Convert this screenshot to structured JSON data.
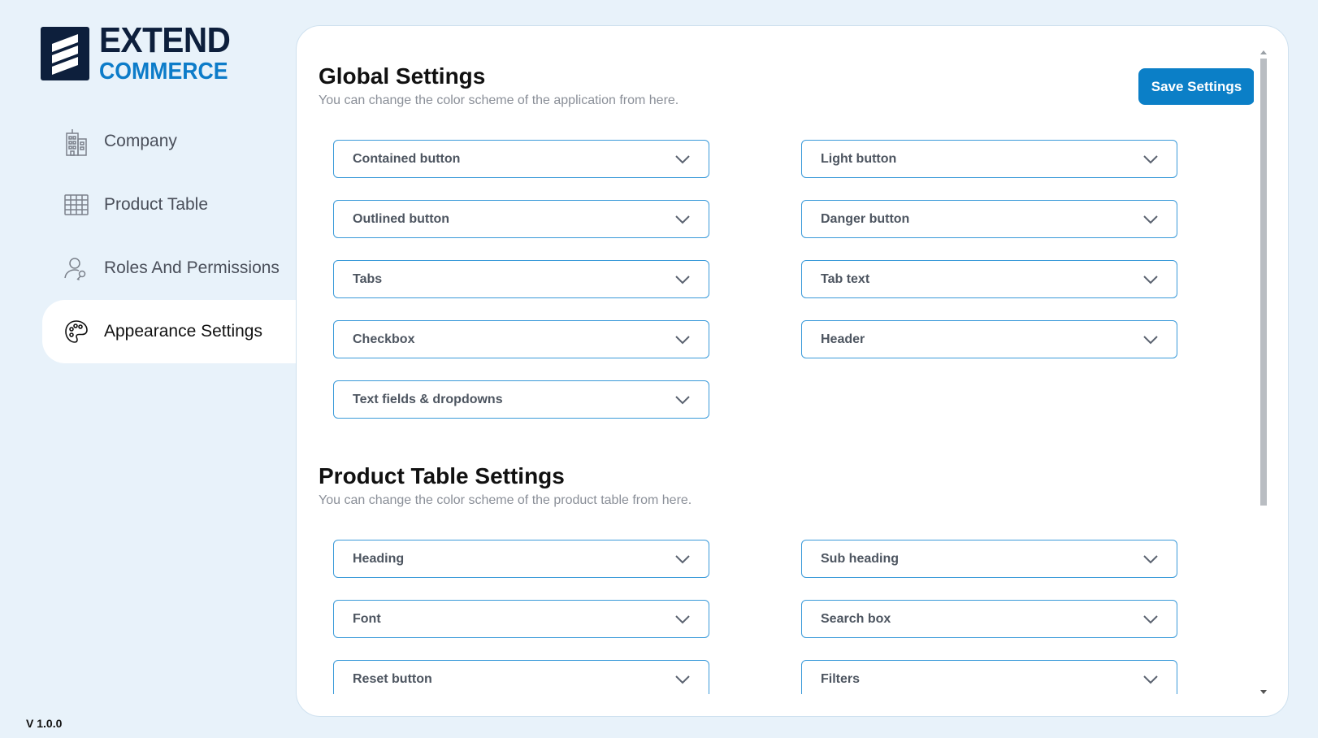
{
  "logo": {
    "line1": "EXTEND",
    "line2": "COMMERCE"
  },
  "nav": {
    "items": [
      {
        "label": "Company",
        "icon": "building-icon",
        "active": false
      },
      {
        "label": "Product Table",
        "icon": "table-grid-icon",
        "active": false
      },
      {
        "label": "Roles And Permissions",
        "icon": "user-key-icon",
        "active": false
      },
      {
        "label": "Appearance Settings",
        "icon": "palette-icon",
        "active": true
      }
    ]
  },
  "version": "V 1.0.0",
  "global": {
    "title": "Global Settings",
    "subtitle": "You can change the color scheme of the application from here.",
    "save_label": "Save Settings",
    "fields": [
      "Contained button",
      "Light button",
      "Outlined button",
      "Danger button",
      "Tabs",
      "Tab text",
      "Checkbox",
      "Header",
      "Text fields & dropdowns"
    ]
  },
  "product_table": {
    "title": "Product Table Settings",
    "subtitle": "You can change the color scheme of the product table from here.",
    "fields": [
      "Heading",
      "Sub heading",
      "Font",
      "Search box",
      "Reset button",
      "Filters"
    ]
  },
  "colors": {
    "background": "#e8f2fa",
    "accent": "#0b7fc7",
    "logo_dark": "#0d1f3c",
    "field_border": "#3a9ad9"
  }
}
